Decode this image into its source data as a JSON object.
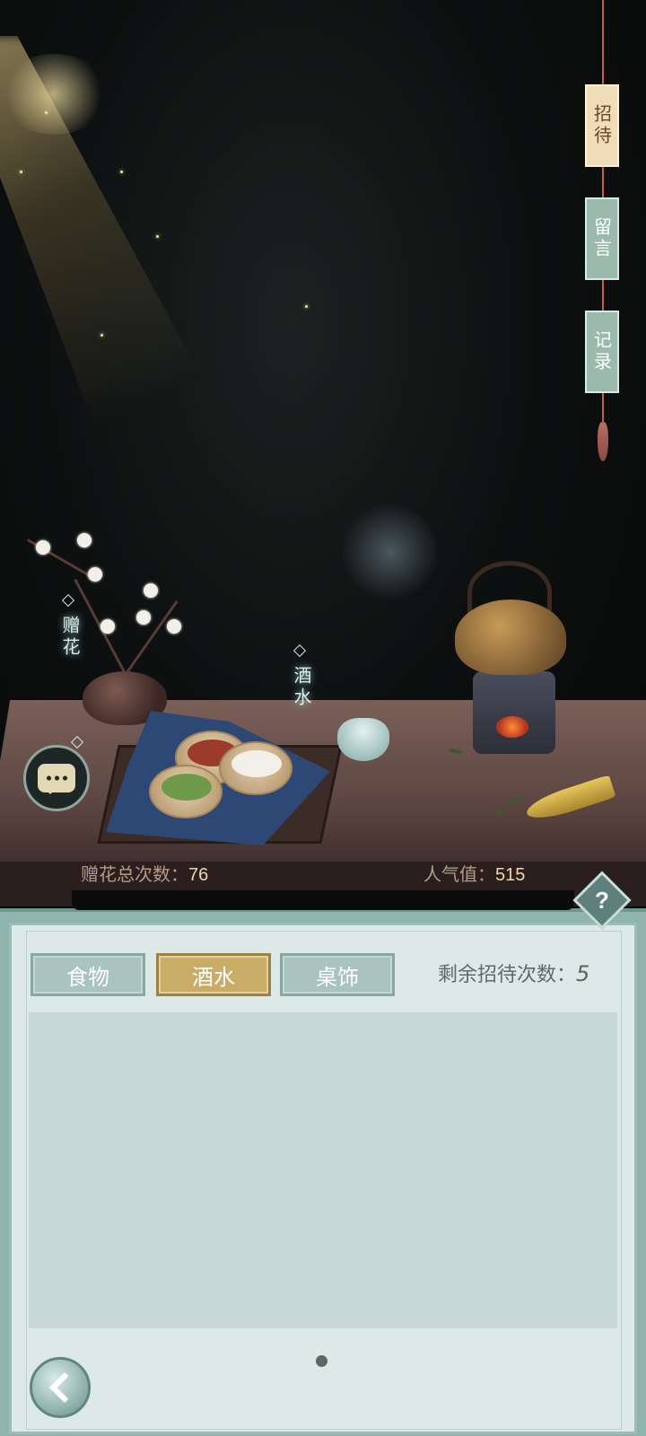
{
  "side_menu": [
    {
      "label": "招待",
      "active": true
    },
    {
      "label": "留言",
      "active": false
    },
    {
      "label": "记录",
      "active": false
    }
  ],
  "scene": {
    "gift_flower_label": "赠花",
    "wine_label": "酒水"
  },
  "stats": {
    "gift_total_label": "赠花总次数：",
    "gift_total_value": "76",
    "popularity_label": "人气值：",
    "popularity_value": "515"
  },
  "panel": {
    "tabs": [
      {
        "label": "食物",
        "active": false
      },
      {
        "label": "酒水",
        "active": true
      },
      {
        "label": "桌饰",
        "active": false
      }
    ],
    "remaining_label": "剩余招待次数：",
    "remaining_value": "5",
    "help_glyph": "?"
  },
  "colors": {
    "active_tab": "#c9ac68",
    "normal_tab": "#a9c3be",
    "panel_bg": "#dde9e6",
    "side_tab_active": "#f1dcb9",
    "side_tab_normal": "#9cb9ad"
  }
}
